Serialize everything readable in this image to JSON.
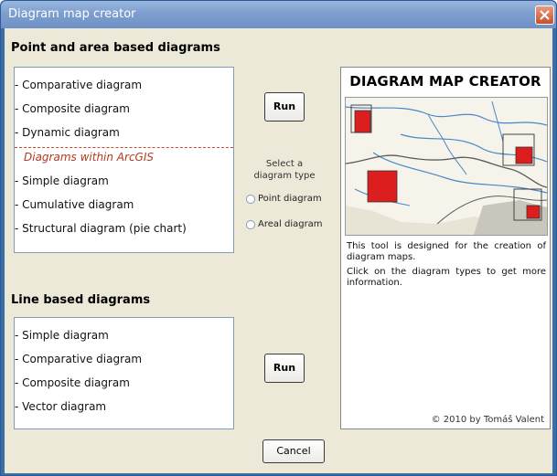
{
  "window": {
    "title": "Diagram map creator"
  },
  "point_area": {
    "heading": "Point and area based diagrams",
    "items": [
      "Comparative diagram",
      "Composite diagram",
      "Dynamic diagram",
      "Diagrams within ArcGIS",
      "Simple diagram",
      "Cumulative diagram",
      "Structural diagram (pie chart)"
    ],
    "run_label": "Run"
  },
  "diagram_type": {
    "label_line1": "Select a",
    "label_line2": "diagram type",
    "options": [
      "Point diagram",
      "Areal diagram"
    ]
  },
  "line_based": {
    "heading": "Line based diagrams",
    "items": [
      "Simple diagram",
      "Comparative diagram",
      "Composite diagram",
      "Vector diagram"
    ],
    "run_label": "Run"
  },
  "info": {
    "title": "DIAGRAM MAP CREATOR",
    "text1": "This tool is designed for the creation of diagram maps.",
    "text2": "Click on the diagram types to get more information.",
    "copyright": "© 2010 by Tomáš Valent"
  },
  "cancel_label": "Cancel",
  "colors": {
    "accent_red": "#dd1e1e",
    "river_blue": "#4a86c9",
    "title_bar": "#7d9ecf"
  }
}
